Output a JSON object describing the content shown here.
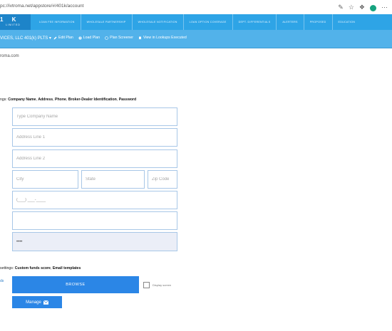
{
  "browser": {
    "url": "pc://ivtroma.net/appstore/#/401k/account"
  },
  "brand": {
    "logo": "1 K",
    "sub": "LIMITED"
  },
  "nav": {
    "items": [
      "LOAN FEE INFORMATION",
      "WHOLESALE PARTNERSHIP",
      "WHOLESALE NOTIFICATION",
      "LOAN OPTION COVERAGE",
      "DEPT. DIFFERENTIALS",
      "ALERTERS",
      "PROPOSED",
      "EDUCATION"
    ]
  },
  "subbar": {
    "plan_label": "VICES, LLC 401(k) PLTS ▾",
    "actions": [
      {
        "icon": "edit-icon",
        "label": "Edit Plan"
      },
      {
        "icon": "load-icon",
        "label": "Load Plan"
      },
      {
        "icon": "screener-icon",
        "label": "Plan Screener"
      },
      {
        "icon": "bookmark-icon",
        "label": "View in Lookups Executed"
      }
    ]
  },
  "content": {
    "domain": "roma.com",
    "settings1": {
      "prefix": "ngs:",
      "items": [
        "Company Name",
        "Address",
        "Phone",
        "Broker-Dealer Identification",
        "Password"
      ]
    },
    "form": {
      "company_name_placeholder": "Type Company Name",
      "address1_placeholder": "Address Line 1",
      "address2_placeholder": "Address Line 2",
      "city_placeholder": "City",
      "state_placeholder": "State",
      "zip_placeholder": "Zip Code",
      "phone_value": "(___) ___-____",
      "broker_value": "",
      "password_value": "••••"
    },
    "settings2": {
      "prefix": "settings:",
      "items": [
        "Custom funds score",
        "Email templates"
      ]
    },
    "side_label": "ds",
    "browse_label": "BROWSE",
    "display_label": "Display screen",
    "manage_label": "Manage"
  },
  "colors": {
    "nav_bg": "#2ea4e6",
    "brand_bg": "#1d84c9",
    "subbar_bg": "#52b2ea",
    "button_bg": "#2b86e6",
    "field_border": "#a8c7e7"
  }
}
